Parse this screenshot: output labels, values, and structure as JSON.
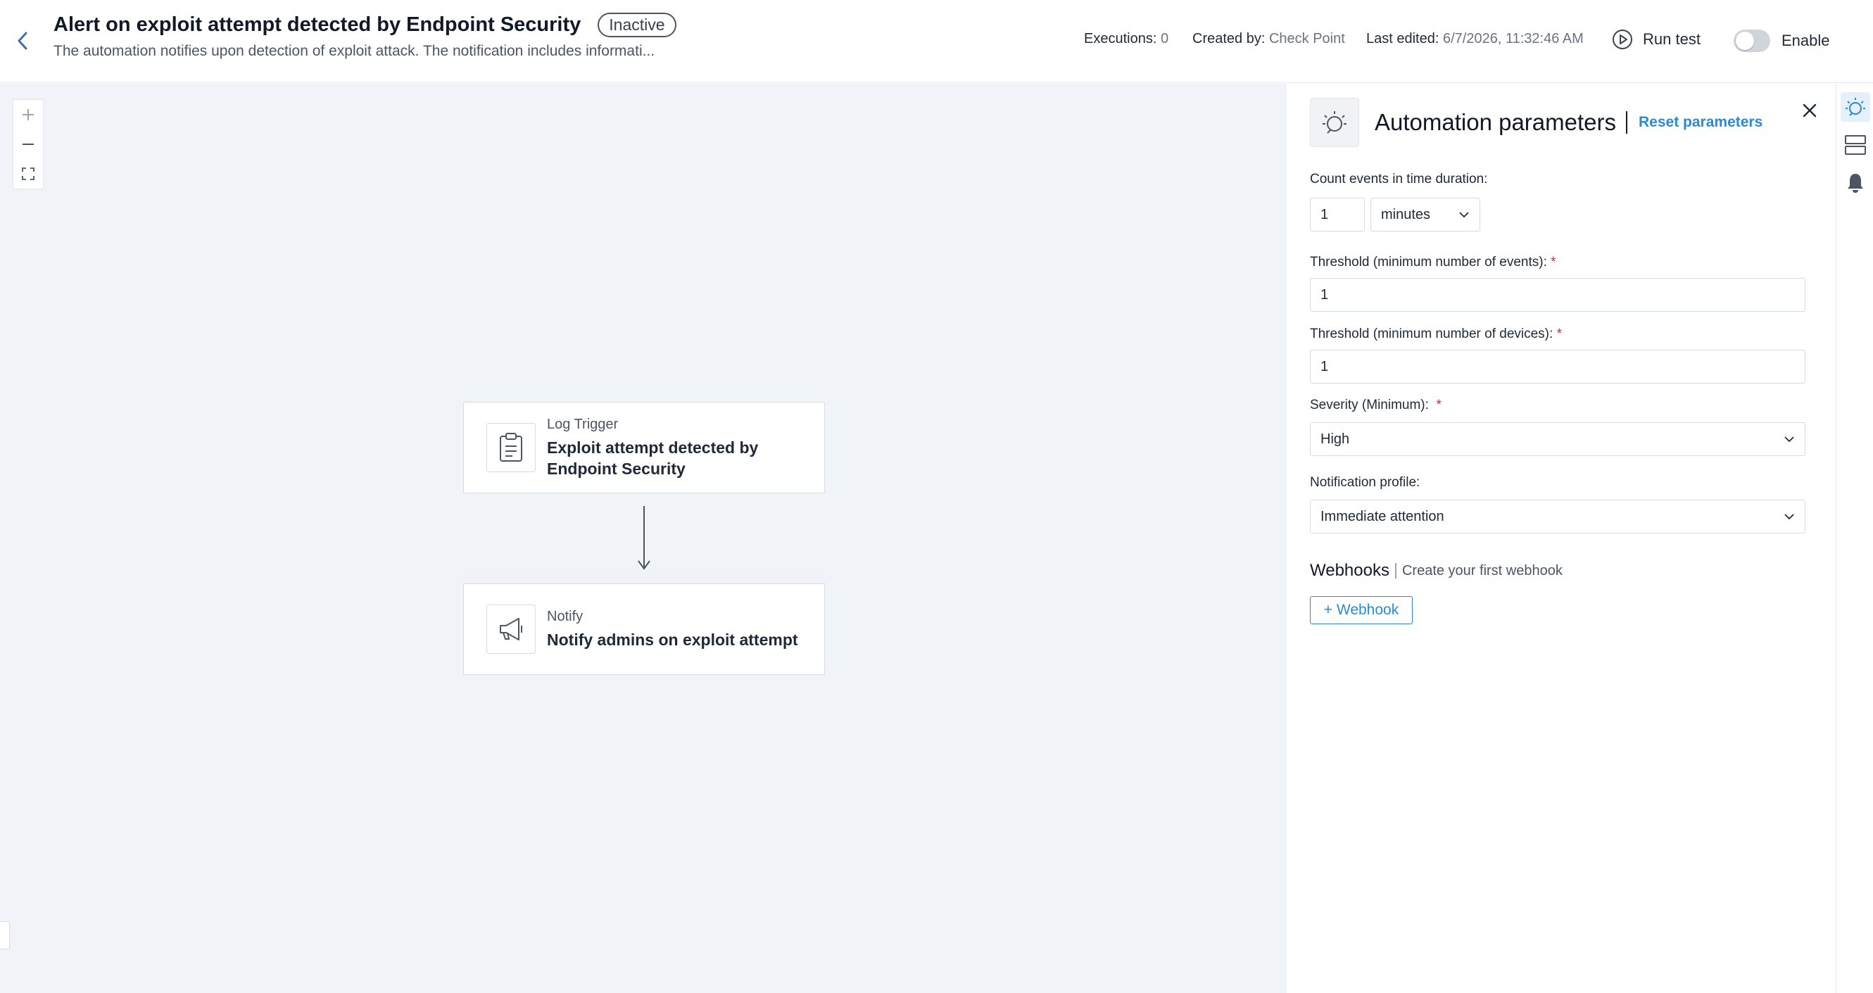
{
  "header": {
    "title": "Alert on exploit attempt detected by Endpoint Security",
    "status": "Inactive",
    "description": "The automation notifies upon detection of exploit attack. The notification includes informati...",
    "executions_label": "Executions:",
    "executions_value": "0",
    "created_by_label": "Created by:",
    "created_by_value": "Check Point",
    "last_edited_label": "Last edited:",
    "last_edited_value": "6/7/2026, 11:32:46 AM",
    "run_test_label": "Run test",
    "enable_label": "Enable",
    "enabled": false
  },
  "canvas": {
    "zoom_in_icon": "plus-icon",
    "zoom_out_icon": "minus-icon",
    "fit_icon": "fullscreen-icon",
    "nodes": [
      {
        "type": "Log Trigger",
        "title": "Exploit attempt detected by Endpoint Security",
        "icon": "clipboard-icon"
      },
      {
        "type": "Notify",
        "title": "Notify admins on exploit attempt",
        "icon": "megaphone-icon"
      }
    ]
  },
  "panel": {
    "title": "Automation parameters",
    "reset_label": "Reset parameters",
    "count_label": "Count events in time duration:",
    "count_value": "1",
    "count_unit": "minutes",
    "threshold_events_label": "Threshold (minimum number of events):",
    "threshold_events_value": "1",
    "threshold_devices_label": "Threshold (minimum number of devices):",
    "threshold_devices_value": "1",
    "severity_label": "Severity (Minimum):",
    "severity_value": "High",
    "notification_label": "Notification profile:",
    "notification_value": "Immediate attention",
    "webhooks_title": "Webhooks",
    "webhooks_sub": "Create your first webhook",
    "webhook_button": "+ Webhook",
    "required_mark": "*"
  },
  "colors": {
    "accent": "#2b8ad6",
    "canvas_bg": "#f0f3f7",
    "required": "#dc2626"
  }
}
